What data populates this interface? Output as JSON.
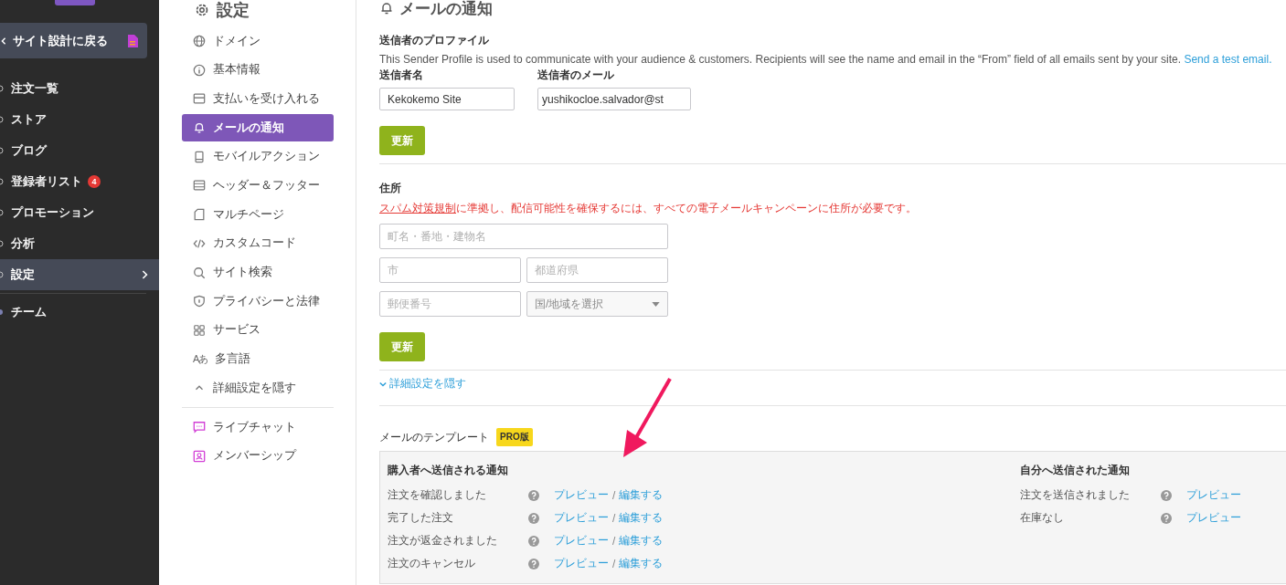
{
  "sidebar": {
    "back_button": "サイト設計に戻る",
    "items": [
      {
        "label": "注文一覧",
        "selected": false
      },
      {
        "label": "ストア",
        "selected": false
      },
      {
        "label": "ブログ",
        "selected": false
      },
      {
        "label": "登録者リスト",
        "selected": false,
        "badge": "4"
      },
      {
        "label": "プロモーション",
        "selected": false
      },
      {
        "label": "分析",
        "selected": false
      },
      {
        "label": "設定",
        "selected": true
      }
    ],
    "footer_item": "チーム"
  },
  "settings_nav": {
    "title": "設定",
    "items": [
      {
        "label": "ドメイン",
        "selected": false
      },
      {
        "label": "基本情報",
        "selected": false
      },
      {
        "label": "支払いを受け入れる",
        "selected": false
      },
      {
        "label": "メールの通知",
        "selected": true
      },
      {
        "label": "モバイルアクション",
        "selected": false
      },
      {
        "label": "ヘッダー＆フッター",
        "selected": false
      },
      {
        "label": "マルチページ",
        "selected": false
      },
      {
        "label": "カスタムコード",
        "selected": false
      },
      {
        "label": "サイト検索",
        "selected": false
      },
      {
        "label": "プライバシーと法律",
        "selected": false
      },
      {
        "label": "サービス",
        "selected": false
      },
      {
        "label": "多言語",
        "selected": false,
        "icon_glyph": "Aあ"
      },
      {
        "label": "詳細設定を隠す",
        "selected": false
      }
    ],
    "extras": [
      {
        "label": "ライブチャット"
      },
      {
        "label": "メンバーシップ"
      }
    ]
  },
  "page_title": "メールの通知",
  "sender_profile": {
    "heading": "送信者のプロファイル",
    "description": "This Sender Profile is used to communicate with your audience & customers. Recipients will see the name and email in the “From” field of all emails sent by your site.",
    "test_link": "Send a test email.",
    "name_label": "送信者名",
    "name_value": "Kekokemo Site",
    "email_label": "送信者のメール",
    "email_value": "yushikocloe.salvador@st",
    "button": "更新"
  },
  "address": {
    "heading": "住所",
    "notice_link": "スパム対策規制",
    "notice": "に準拠し、配信可能性を確保するには、すべての電子メールキャンペーンに住所が必要です。",
    "street_placeholder": "町名・番地・建物名",
    "city_placeholder": "市",
    "prefecture_placeholder": "都道府県",
    "postal_placeholder": "郵便番号",
    "country_select": "国/地域を選択",
    "button": "更新"
  },
  "advanced_toggle": "詳細設定を隠す",
  "templates": {
    "heading": "メールのテンプレート",
    "badge": "PRO版",
    "buyer": {
      "heading": "購入者へ送信される通知",
      "rows": [
        {
          "name": "注文を確認しました",
          "preview": "プレビュー",
          "separator": "/",
          "edit": "編集する"
        },
        {
          "name": "完了した注文",
          "preview": "プレビュー",
          "separator": "/",
          "edit": "編集する"
        },
        {
          "name": "注文が返金されました",
          "preview": "プレビュー",
          "separator": "/",
          "edit": "編集する"
        },
        {
          "name": "注文のキャンセル",
          "preview": "プレビュー",
          "separator": "/",
          "edit": "編集する"
        }
      ]
    },
    "owner": {
      "heading": "自分へ送信された通知",
      "rows": [
        {
          "name": "注文を送信されました",
          "preview": "プレビュー"
        },
        {
          "name": "在庫なし",
          "preview": "プレビュー"
        }
      ]
    }
  }
}
